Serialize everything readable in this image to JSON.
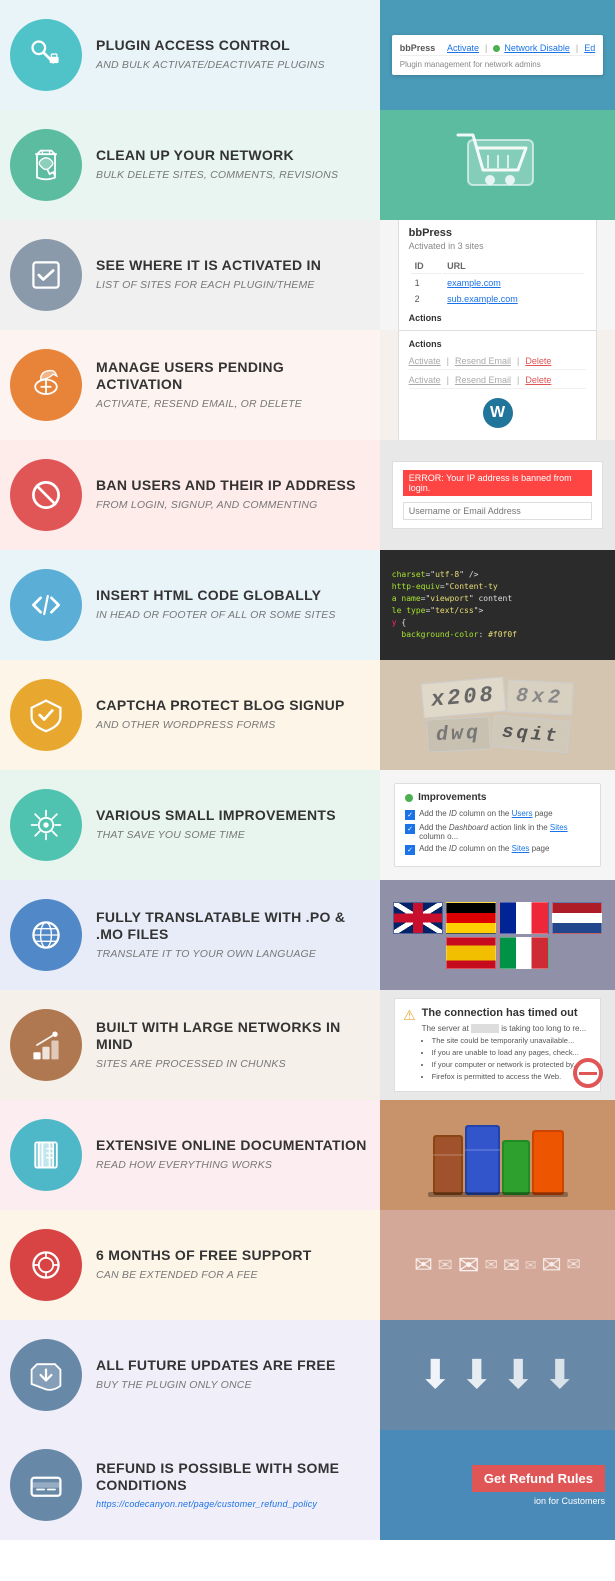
{
  "features": [
    {
      "id": "plugin-access-control",
      "icon_color": "icon-teal",
      "icon_glyph": "🔌",
      "bg_left": "#e8f4f8",
      "title": "PLUGIN ACCESS CONTROL",
      "subtitle": "AND BULK ACTIVATE/DEACTIVATE PLUGINS",
      "panel_type": "access-control"
    },
    {
      "id": "clean-up-network",
      "icon_color": "icon-teal2",
      "icon_glyph": "♻",
      "bg_left": "#e8f5f0",
      "title": "CLEAN UP YOUR NETWORK",
      "subtitle": "BULK DELETE SITES, COMMENTS, REVISIONS",
      "panel_type": "cleanup"
    },
    {
      "id": "see-where-activated",
      "icon_color": "icon-gray",
      "icon_glyph": "☑",
      "bg_left": "#f0f0f0",
      "title": "SEE WHERE IT IS ACTIVATED IN",
      "subtitle": "LIST OF SITES FOR EACH PLUGIN/THEME",
      "panel_type": "bbpress"
    },
    {
      "id": "manage-users-pending",
      "icon_color": "icon-orange",
      "icon_glyph": "⏳",
      "bg_left": "#fdf3f0",
      "title": "MANAGE USERS PENDING ACTIVATION",
      "subtitle": "ACTIVATE, RESEND EMAIL, OR DELETE",
      "panel_type": "users-pending"
    },
    {
      "id": "ban-users",
      "icon_color": "icon-red",
      "icon_glyph": "🚫",
      "bg_left": "#fdecea",
      "title": "BAN USERS AND THEIR IP ADDRESS",
      "subtitle": "FROM LOGIN, SIGNUP, AND COMMENTING",
      "panel_type": "ban-users"
    },
    {
      "id": "insert-html",
      "icon_color": "icon-blue",
      "icon_glyph": "</>",
      "bg_left": "#e8f4f8",
      "title": "INSERT HTML CODE GLOBALLY",
      "subtitle": "IN HEAD OR FOOTER OF ALL OR SOME SITES",
      "panel_type": "html-code"
    },
    {
      "id": "captcha",
      "icon_color": "icon-gold",
      "icon_glyph": "🛡",
      "bg_left": "#fdf6e8",
      "title": "CAPTCHA PROTECT BLOG SIGNUP",
      "subtitle": "AND OTHER WORDPRESS FORMS",
      "panel_type": "captcha"
    },
    {
      "id": "improvements",
      "icon_color": "icon-teal3",
      "icon_glyph": "⚛",
      "bg_left": "#e8f5ee",
      "title": "VARIOUS SMALL IMPROVEMENTS",
      "subtitle": "THAT SAVE YOU SOME TIME",
      "panel_type": "improvements"
    },
    {
      "id": "translatable",
      "icon_color": "icon-blue2",
      "icon_glyph": "🌐",
      "bg_left": "#e8ecf8",
      "title": "FULLY TRANSLATABLE WITH .PO & .MO FILES",
      "subtitle": "TRANSLATE IT TO YOUR OWN LANGUAGE",
      "panel_type": "flags"
    },
    {
      "id": "large-networks",
      "icon_color": "icon-brown",
      "icon_glyph": "📚",
      "bg_left": "#f5f0ea",
      "title": "BUILT WITH LARGE NETWORKS IN MIND",
      "subtitle": "SITES ARE PROCESSED IN CHUNKS",
      "panel_type": "timeout"
    },
    {
      "id": "documentation",
      "icon_color": "icon-teal4",
      "icon_glyph": "📄",
      "bg_left": "#fcedf0",
      "title": "EXTENSIVE ONLINE DOCUMENTATION",
      "subtitle": "READ HOW EVERYTHING WORKS",
      "panel_type": "books"
    },
    {
      "id": "free-support",
      "icon_color": "icon-red2",
      "icon_glyph": "🆘",
      "bg_left": "#fdf5e8",
      "title": "6 MONTHS OF FREE SUPPORT",
      "subtitle": "CAN BE EXTENDED FOR A FEE",
      "panel_type": "envelopes"
    },
    {
      "id": "future-updates",
      "icon_color": "icon-gray2",
      "icon_glyph": "⬇",
      "bg_left": "#f0eef8",
      "title": "ALL FUTURE UPDATES ARE FREE",
      "subtitle": "BUY THE PLUGIN ONLY ONCE",
      "panel_type": "arrows"
    },
    {
      "id": "refund",
      "icon_color": "icon-gray2",
      "icon_glyph": "💵",
      "bg_left": "#f0eef8",
      "title": "REFUND IS POSSIBLE WITH SOME CONDITIONS",
      "subtitle": "https://codecanyon.net/page/customer_refund_policy",
      "panel_type": "refund"
    }
  ],
  "panels": {
    "access_control": {
      "plugin_name": "bbPress",
      "actions": "Activate | ● Network Disable | Ed",
      "dot_label": "Network Disable"
    },
    "bbpress": {
      "title": "bbPress",
      "activated": "Activated in 3 sites",
      "col_id": "ID",
      "col_url": "URL",
      "section": "Actions"
    },
    "users_pending": {
      "actions_title": "Actions",
      "row1": [
        "Activate",
        "Resend Email",
        "Delete"
      ],
      "row2": [
        "Activate",
        "Resend Email",
        "Delete"
      ]
    },
    "ban_users": {
      "error_text": "ERROR: Your IP address is banned from login.",
      "placeholder": "Username or Email Address"
    },
    "improvements": {
      "title": "Improvements",
      "items": [
        "Add the ID column on the Users page",
        "Add the Dashboard action link in the Sites column o...",
        "Add the ID column on the Sites page"
      ]
    },
    "timeout": {
      "title": "The connection has timed out",
      "message": "The server at [redacted] is taking too long to re...",
      "bullets": [
        "The site could be temporarily unavailable...",
        "If you are unable to load any pages, check...",
        "If your computer or network is protected by..."
      ]
    },
    "refund": {
      "button_text": "Get Refund Rules",
      "sub_text": "ion for Customers"
    }
  }
}
